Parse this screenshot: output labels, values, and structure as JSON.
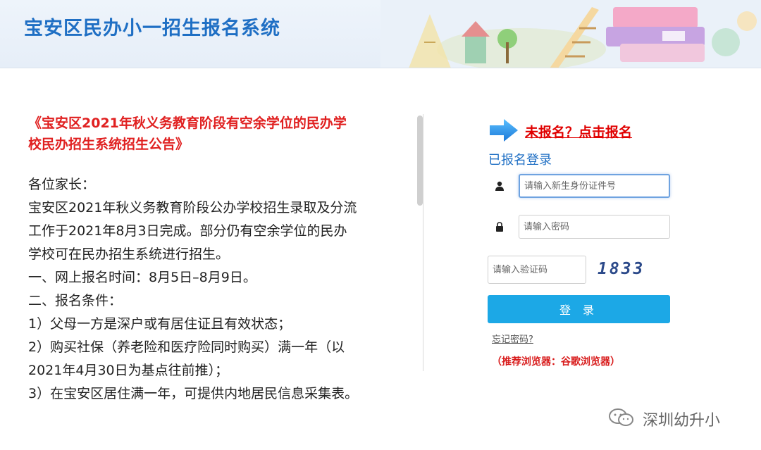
{
  "header": {
    "title": "宝安区民办小一招生报名系统"
  },
  "notice": {
    "title": "《宝安区2021年秋义务教育阶段有空余学位的民办学校民办招生系统招生公告》",
    "paragraphs": [
      "各位家长：",
      "宝安区2021年秋义务教育阶段公办学校招生录取及分流工作于2021年8月3日完成。部分仍有空余学位的民办学校可在民办招生系统进行招生。",
      "一、网上报名时间：8月5日–8月9日。",
      "二、报名条件：",
      "1）父母一方是深户或有居住证且有效状态；",
      "2）购买社保（养老险和医疗险同时购买）满一年（以2021年4月30日为基点往前推）；",
      "3）在宝安区居住满一年，可提供内地居民信息采集表。"
    ]
  },
  "login": {
    "register_link": "未报名？点击报名",
    "heading": "已报名登录",
    "id_placeholder": "请输入新生身份证件号",
    "password_placeholder": "请输入密码",
    "captcha_placeholder": "请输入验证码",
    "captcha_code": "1833",
    "login_button": "登 录",
    "forgot_password": "忘记密码?",
    "browser_tip": "（推荐浏览器：谷歌浏览器）"
  },
  "watermark": {
    "text": "深圳幼升小"
  },
  "colors": {
    "brand_blue": "#1f6fc4",
    "button_blue": "#1ca8e6",
    "alert_red": "#e00000"
  },
  "icons": [
    "arrow-right-icon",
    "user-icon",
    "lock-icon",
    "wechat-icon"
  ]
}
